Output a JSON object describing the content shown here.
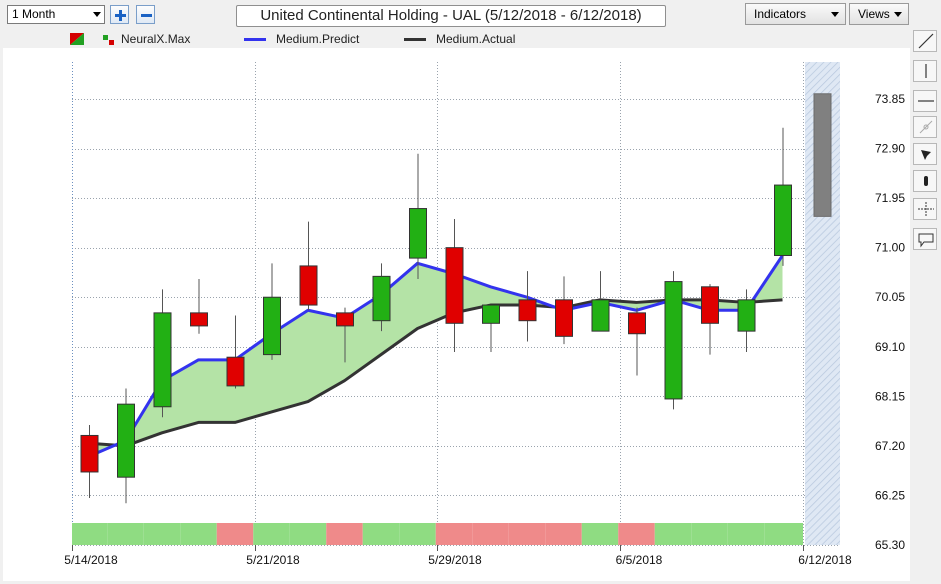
{
  "toolbar": {
    "period": "1 Month",
    "title": "United Continental Holding - UAL (5/12/2018 - 6/12/2018)",
    "indicators_label": "Indicators",
    "views_label": "Views"
  },
  "legend": [
    {
      "label": "NeuralX.Max",
      "color": "#d40000"
    },
    {
      "label": "Medium.Predict",
      "color": "#3333ee"
    },
    {
      "label": "Medium.Actual",
      "color": "#333333"
    }
  ],
  "tools": [
    "line-tool-icon",
    "vertical-line-icon",
    "horizontal-line-icon",
    "trend-channel-icon",
    "pen-icon",
    "marker-icon",
    "crosshair-icon",
    "annotation-icon"
  ],
  "chart_data": {
    "type": "candlestick",
    "ylim": [
      65.3,
      74.5
    ],
    "y_ticks": [
      "73.85",
      "72.90",
      "71.95",
      "71.00",
      "70.05",
      "69.10",
      "68.15",
      "67.20",
      "66.25",
      "65.30"
    ],
    "x_ticks": [
      "5/14/2018",
      "5/21/2018",
      "5/29/2018",
      "6/5/2018",
      "6/12/2018"
    ],
    "candles": [
      {
        "open": 67.4,
        "high": 67.6,
        "low": 66.2,
        "close": 66.7,
        "color": "red"
      },
      {
        "open": 66.6,
        "high": 68.3,
        "low": 66.1,
        "close": 68.0,
        "color": "green"
      },
      {
        "open": 67.95,
        "high": 70.2,
        "low": 67.75,
        "close": 69.75,
        "color": "green"
      },
      {
        "open": 69.75,
        "high": 70.4,
        "low": 69.35,
        "close": 69.5,
        "color": "red"
      },
      {
        "open": 68.9,
        "high": 69.7,
        "low": 68.3,
        "close": 68.35,
        "color": "red"
      },
      {
        "open": 68.95,
        "high": 70.7,
        "low": 68.85,
        "close": 70.05,
        "color": "green"
      },
      {
        "open": 70.65,
        "high": 71.5,
        "low": 69.8,
        "close": 69.9,
        "color": "red"
      },
      {
        "open": 69.75,
        "high": 69.85,
        "low": 68.8,
        "close": 69.5,
        "color": "red"
      },
      {
        "open": 69.6,
        "high": 70.7,
        "low": 69.4,
        "close": 70.45,
        "color": "green"
      },
      {
        "open": 70.8,
        "high": 72.8,
        "low": 70.4,
        "close": 71.75,
        "color": "green"
      },
      {
        "open": 71.0,
        "high": 71.55,
        "low": 69.0,
        "close": 69.55,
        "color": "red"
      },
      {
        "open": 69.55,
        "high": 69.9,
        "low": 69.0,
        "close": 69.9,
        "color": "green"
      },
      {
        "open": 70.0,
        "high": 70.55,
        "low": 69.2,
        "close": 69.6,
        "color": "red"
      },
      {
        "open": 70.0,
        "high": 70.45,
        "low": 69.15,
        "close": 69.3,
        "color": "red"
      },
      {
        "open": 69.4,
        "high": 70.55,
        "low": 69.4,
        "close": 70.0,
        "color": "green"
      },
      {
        "open": 69.75,
        "high": 69.85,
        "low": 68.55,
        "close": 69.35,
        "color": "red"
      },
      {
        "open": 68.1,
        "high": 70.55,
        "low": 67.9,
        "close": 70.35,
        "color": "green"
      },
      {
        "open": 70.25,
        "high": 70.3,
        "low": 68.95,
        "close": 69.55,
        "color": "red"
      },
      {
        "open": 69.4,
        "high": 70.2,
        "low": 69.0,
        "close": 70.0,
        "color": "green"
      },
      {
        "open": 70.85,
        "high": 73.3,
        "low": 70.65,
        "close": 72.2,
        "color": "green"
      }
    ],
    "predict_line": [
      67.0,
      67.3,
      68.45,
      68.85,
      68.85,
      69.35,
      69.8,
      69.65,
      70.1,
      70.7,
      70.5,
      70.25,
      70.05,
      69.8,
      69.95,
      69.8,
      70.0,
      69.8,
      69.8,
      70.85
    ],
    "actual_line": [
      67.25,
      67.2,
      67.45,
      67.65,
      67.65,
      67.85,
      68.05,
      68.45,
      68.95,
      69.45,
      69.75,
      69.9,
      69.9,
      69.85,
      70.0,
      69.95,
      70.0,
      70.0,
      69.95,
      70.0
    ],
    "forecast_box": {
      "top": 73.95,
      "bottom": 71.6
    },
    "signal_bar": [
      "green",
      "green",
      "green",
      "green",
      "red",
      "green",
      "green",
      "red",
      "green",
      "green",
      "red",
      "red",
      "red",
      "red",
      "green",
      "red",
      "green",
      "green",
      "green",
      "green"
    ]
  }
}
